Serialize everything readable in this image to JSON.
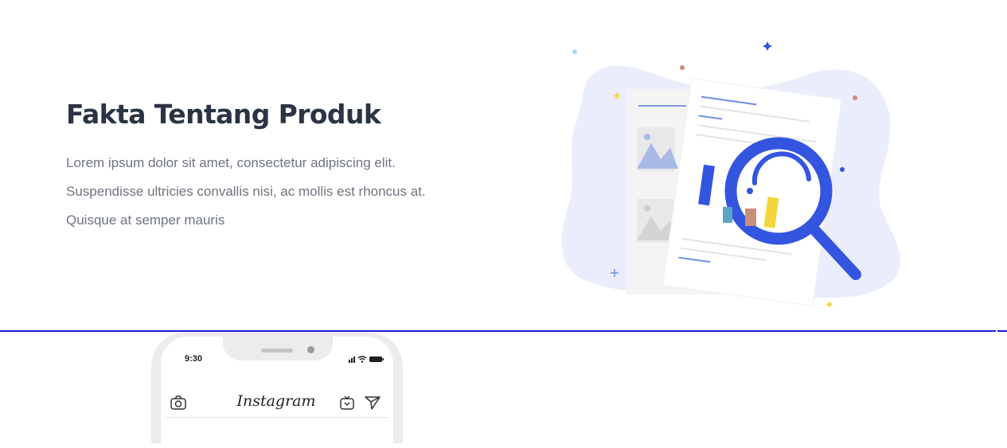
{
  "hero": {
    "title": "Fakta Tentang Produk",
    "paragraph_lines": [
      "Lorem ipsum dolor sit amet, consectetur adipiscing elit.",
      "Suspendisse ultricies convallis nisi, ac mollis est rhoncus at.",
      "Quisque at semper mauris"
    ]
  },
  "colors": {
    "heading": "#2b3445",
    "body_text": "#6e7480",
    "accent_blue": "#3355e0",
    "divider": "#1a1ae0",
    "blob": "#eaedfb"
  },
  "phone": {
    "status_time": "9:30",
    "app_name": "Instagram",
    "icons": [
      "camera-icon",
      "igtv-icon",
      "send-icon",
      "signal-icon",
      "wifi-icon",
      "battery-icon"
    ]
  }
}
